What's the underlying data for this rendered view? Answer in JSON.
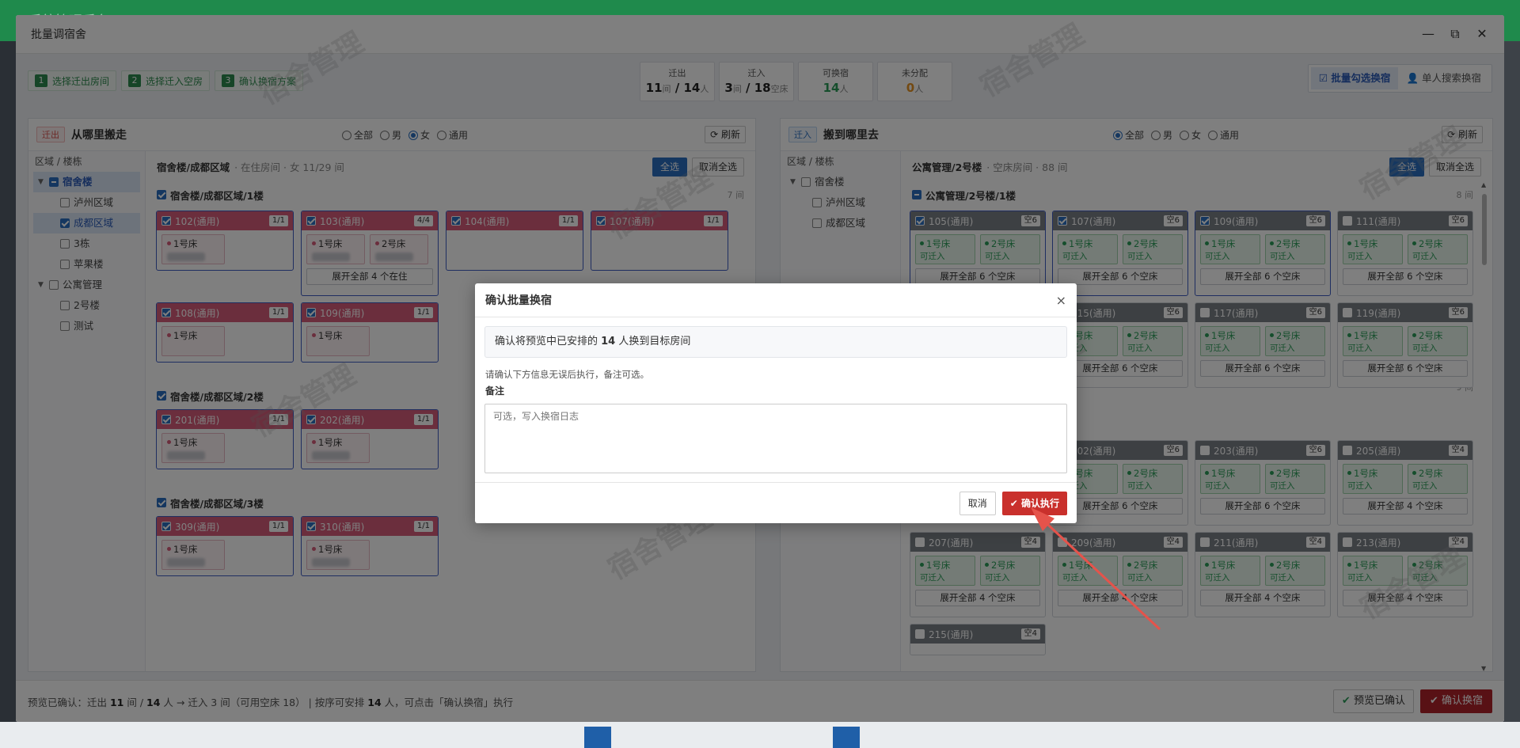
{
  "background": {
    "app_title": "系统管理后台"
  },
  "modal": {
    "title": "批量调宿舍",
    "steps": [
      {
        "num": "1",
        "label": "选择迁出房间"
      },
      {
        "num": "2",
        "label": "选择迁入空房"
      },
      {
        "num": "3",
        "label": "确认换宿方案"
      }
    ],
    "stats": [
      {
        "label": "迁出",
        "a": "11",
        "u1": "间",
        "sep": " / ",
        "b": "14",
        "u2": "人"
      },
      {
        "label": "迁入",
        "a": "3",
        "u1": "间",
        "sep": " / ",
        "b": "18",
        "u2": "空床"
      },
      {
        "label": "可换宿",
        "a": "14",
        "u1": "人"
      },
      {
        "label": "未分配",
        "a": "0",
        "u1": "人"
      }
    ],
    "mode_batch": "批量勾选换宿",
    "mode_single": "单人搜索换宿",
    "watermark": "宿舍管理"
  },
  "left": {
    "tag": "迁出",
    "title": "从哪里搬走",
    "radios": [
      "全部",
      "男",
      "女",
      "通用"
    ],
    "refresh": "刷新",
    "tree_header": "区域 / 楼栋",
    "tree": [
      "宿舍楼",
      "泸州区域",
      "成都区域",
      "3栋",
      "苹果楼",
      "公寓管理",
      "2号楼",
      "测试"
    ],
    "content_title": "宿舍楼/成都区域",
    "content_sub": "· 在住房间 · 女 11/29 间",
    "select_all": "全选",
    "deselect_all": "取消全选",
    "groups": [
      {
        "name": "宿舍楼/成都区域/1楼",
        "count": "7 间"
      },
      {
        "name": "宿舍楼/成都区域/2楼",
        "count": ""
      },
      {
        "name": "宿舍楼/成都区域/3楼",
        "count": "2 间"
      }
    ],
    "rooms": [
      {
        "name": "102(通用)",
        "badge": "1/1"
      },
      {
        "name": "103(通用)",
        "badge": "4/4"
      },
      {
        "name": "104(通用)",
        "badge": "1/1"
      },
      {
        "name": "107(通用)",
        "badge": "1/1"
      },
      {
        "name": "108(通用)",
        "badge": "1/1"
      },
      {
        "name": "109(通用)",
        "badge": "1/1"
      },
      {
        "name": "201(通用)",
        "badge": "1/1"
      },
      {
        "name": "202(通用)",
        "badge": "1/1"
      },
      {
        "name": "309(通用)",
        "badge": "1/1"
      },
      {
        "name": "310(通用)",
        "badge": "1/1"
      }
    ],
    "bed1": "1号床",
    "bed2": "2号床",
    "expand_occupied": "展开全部 4 个在住"
  },
  "right": {
    "tag": "迁入",
    "title": "搬到哪里去",
    "radios": [
      "全部",
      "男",
      "女",
      "通用"
    ],
    "refresh": "刷新",
    "tree_header": "区域 / 楼栋",
    "tree": [
      "宿舍楼",
      "泸州区域",
      "成都区域"
    ],
    "content_title": "公寓管理/2号楼",
    "content_sub": "· 空床房间 · 88 间",
    "select_all": "全选",
    "deselect_all": "取消全选",
    "groups": [
      {
        "name": "公寓管理/2号楼/1楼",
        "count": "8 间"
      },
      {
        "name": "",
        "count": "9 间"
      }
    ],
    "rooms": [
      {
        "name": "105(通用)",
        "badge": "空6"
      },
      {
        "name": "107(通用)",
        "badge": "空6"
      },
      {
        "name": "109(通用)",
        "badge": "空6"
      },
      {
        "name": "111(通用)",
        "badge": "空6"
      },
      {
        "name": "115(通用)",
        "badge": "空6"
      },
      {
        "name": "117(通用)",
        "badge": "空6"
      },
      {
        "name": "119(通用)",
        "badge": "空6"
      },
      {
        "name": "202(通用)",
        "badge": "空6"
      },
      {
        "name": "203(通用)",
        "badge": "空6"
      },
      {
        "name": "205(通用)",
        "badge": "空4"
      },
      {
        "name": "207(通用)",
        "badge": "空4"
      },
      {
        "name": "209(通用)",
        "badge": "空4"
      },
      {
        "name": "211(通用)",
        "badge": "空4"
      },
      {
        "name": "213(通用)",
        "badge": "空4"
      },
      {
        "name": "215(通用)",
        "badge": "空4"
      }
    ],
    "bed1": "1号床",
    "bed2": "2号床",
    "can_move": "可迁入",
    "expand6": "展开全部 6 个空床",
    "expand4": "展开全部 4 个空床"
  },
  "footer": {
    "p1": "预览已确认：迁出 ",
    "n1": "11",
    "p2": " 间 / ",
    "n2": "14",
    "p3": " 人 → 迁入 3 间（可用空床 18） | 按序可安排 ",
    "n3": "14",
    "p4": " 人，可点击「确认换宿」执行",
    "preview_btn": "预览已确认",
    "confirm_btn": "确认换宿"
  },
  "dialog": {
    "title": "确认批量换宿",
    "info_pre": "确认将预览中已安排的 ",
    "info_num": "14",
    "info_post": " 人换到目标房间",
    "hint": "请确认下方信息无误后执行，备注可选。",
    "label": "备注",
    "placeholder": "可选，写入换宿日志",
    "cancel": "取消",
    "confirm": "确认执行"
  },
  "colors": {
    "accent": "#2a6fc0",
    "occupied": "#d65c7a",
    "danger": "#c9302c",
    "green": "#2a9d58"
  }
}
